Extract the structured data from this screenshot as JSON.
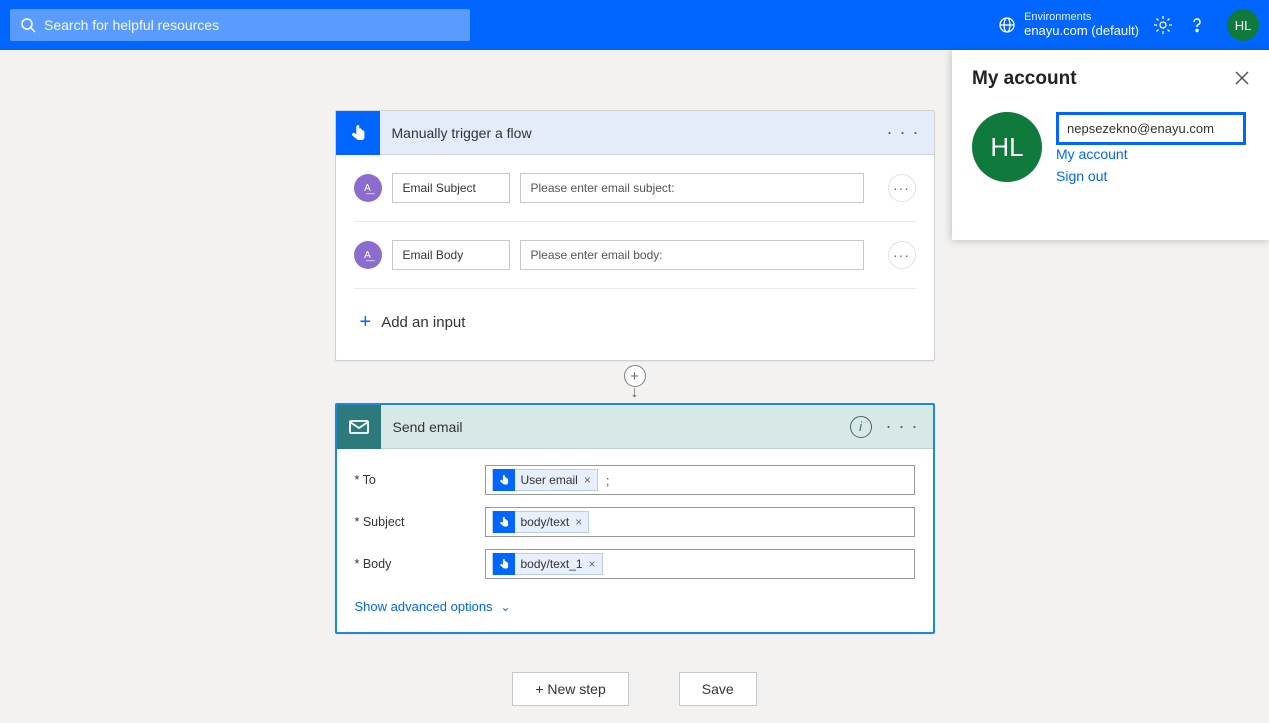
{
  "header": {
    "search_placeholder": "Search for helpful resources",
    "env_label": "Environments",
    "env_name": "enayu.com (default)",
    "avatar_initials": "HL"
  },
  "trigger_card": {
    "title": "Manually trigger a flow",
    "rows": [
      {
        "label": "Email Subject",
        "placeholder": "Please enter email subject:"
      },
      {
        "label": "Email Body",
        "placeholder": "Please enter email body:"
      }
    ],
    "add_input_label": "Add an input"
  },
  "action_card": {
    "title": "Send email",
    "fields": {
      "to": {
        "label": "* To",
        "token": "User email",
        "suffix": ";"
      },
      "subject": {
        "label": "* Subject",
        "token": "body/text"
      },
      "body": {
        "label": "* Body",
        "token": "body/text_1"
      }
    },
    "advanced_label": "Show advanced options"
  },
  "footer": {
    "new_step": "+ New step",
    "save": "Save"
  },
  "account_panel": {
    "title": "My account",
    "avatar_initials": "HL",
    "email": "nepsezekno@enayu.com",
    "links": {
      "my_account": "My account",
      "sign_out": "Sign out"
    }
  }
}
